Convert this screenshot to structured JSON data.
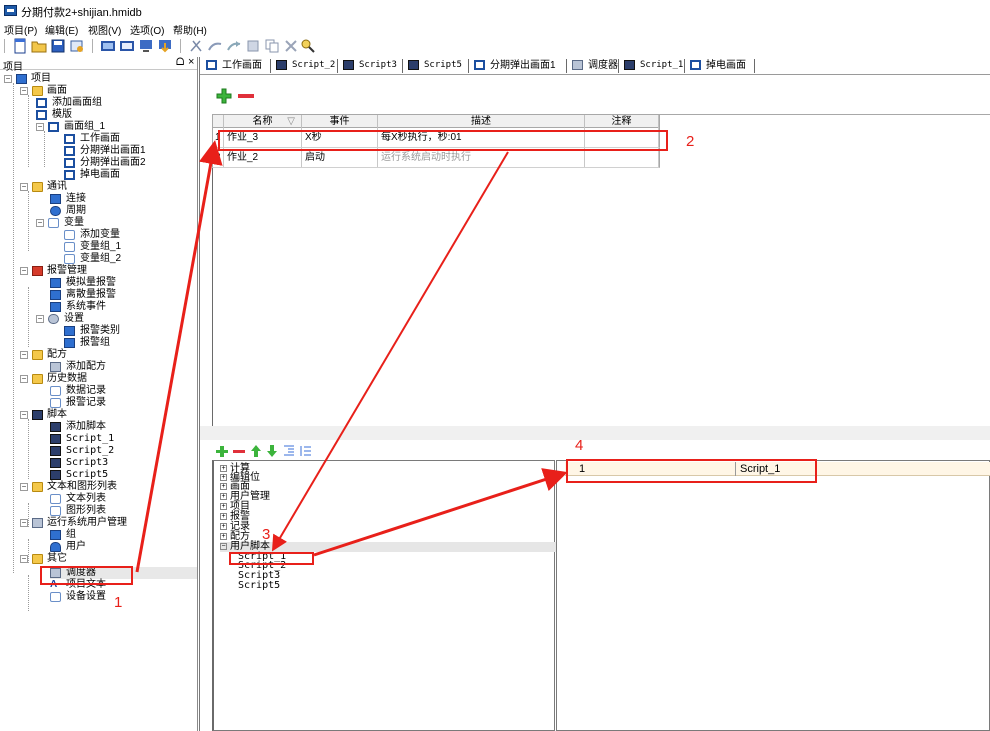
{
  "window": {
    "title": "分期付款2+shijian.hmidb"
  },
  "menu": [
    "项目(P)",
    "编辑(E)",
    "视图(V)",
    "选项(O)",
    "帮助(H)"
  ],
  "left_pane": {
    "header": "项目",
    "pin_icon": "pin-icon",
    "close_icon": "×",
    "tree": [
      {
        "label": "项目",
        "icon": "project-icon"
      },
      {
        "label": "画面",
        "icon": "folder-screen-icon"
      },
      {
        "label": "添加画面组",
        "icon": "screen-icon"
      },
      {
        "label": "模版",
        "icon": "screen-icon"
      },
      {
        "label": "画面组_1",
        "icon": "screen-icon"
      },
      {
        "label": "工作画面",
        "icon": "screen-icon"
      },
      {
        "label": "分期弹出画面1",
        "icon": "screen-icon"
      },
      {
        "label": "分期弹出画面2",
        "icon": "screen-icon"
      },
      {
        "label": "掉电画面",
        "icon": "screen-icon"
      },
      {
        "label": "通讯",
        "icon": "comm-icon"
      },
      {
        "label": "连接",
        "icon": "connection-icon"
      },
      {
        "label": "周期",
        "icon": "cycle-icon"
      },
      {
        "label": "变量",
        "icon": "variable-icon"
      },
      {
        "label": "添加变量",
        "icon": "variable-icon"
      },
      {
        "label": "变量组_1",
        "icon": "variable-icon"
      },
      {
        "label": "变量组_2",
        "icon": "variable-icon"
      },
      {
        "label": "报警管理",
        "icon": "alarm-icon"
      },
      {
        "label": "模拟量报警",
        "icon": "alarm-icon"
      },
      {
        "label": "离散量报警",
        "icon": "alarm-icon"
      },
      {
        "label": "系统事件",
        "icon": "alarm-icon"
      },
      {
        "label": "设置",
        "icon": "settings-icon"
      },
      {
        "label": "报警类别",
        "icon": "alarm-icon"
      },
      {
        "label": "报警组",
        "icon": "alarm-icon"
      },
      {
        "label": "配方",
        "icon": "recipe-icon"
      },
      {
        "label": "添加配方",
        "icon": "recipe-icon"
      },
      {
        "label": "历史数据",
        "icon": "history-icon"
      },
      {
        "label": "数据记录",
        "icon": "log-icon"
      },
      {
        "label": "报警记录",
        "icon": "log-icon"
      },
      {
        "label": "脚本",
        "icon": "script-icon"
      },
      {
        "label": "添加脚本",
        "icon": "script-icon"
      },
      {
        "label": "Script_1",
        "icon": "script-icon"
      },
      {
        "label": "Script_2",
        "icon": "script-icon"
      },
      {
        "label": "Script3",
        "icon": "script-icon"
      },
      {
        "label": "Script5",
        "icon": "script-icon"
      },
      {
        "label": "文本和图形列表",
        "icon": "list-icon"
      },
      {
        "label": "文本列表",
        "icon": "list-icon"
      },
      {
        "label": "图形列表",
        "icon": "list-icon"
      },
      {
        "label": "运行系统用户管理",
        "icon": "user-admin-icon"
      },
      {
        "label": "组",
        "icon": "group-icon"
      },
      {
        "label": "用户",
        "icon": "user-icon"
      },
      {
        "label": "其它",
        "icon": "folder-icon"
      },
      {
        "label": "调度器",
        "icon": "scheduler-icon"
      },
      {
        "label": "项目文本",
        "icon": "text-icon"
      },
      {
        "label": "设备设置",
        "icon": "device-icon"
      }
    ]
  },
  "tabs": [
    {
      "label": "工作画面",
      "icon": "screen-icon"
    },
    {
      "label": "Script_2",
      "icon": "script-icon"
    },
    {
      "label": "Script3",
      "icon": "script-icon"
    },
    {
      "label": "Script5",
      "icon": "script-icon"
    },
    {
      "label": "分期弹出画面1",
      "icon": "screen-icon"
    },
    {
      "label": "调度器",
      "icon": "scheduler-icon"
    },
    {
      "label": "Script_1",
      "icon": "script-icon"
    },
    {
      "label": "掉电画面",
      "icon": "screen-icon"
    }
  ],
  "task_table": {
    "columns": [
      "名称",
      "事件",
      "描述",
      "注释"
    ],
    "rows": [
      {
        "num": "1",
        "name": "作业_3",
        "event": "X秒",
        "desc": "每X秒执行，秒:01",
        "note": ""
      },
      {
        "num": "2",
        "name": "作业_2",
        "event": "启动",
        "desc": "运行系统启动时执行",
        "note": ""
      }
    ]
  },
  "function_tree": {
    "items": [
      {
        "label": "计算",
        "expander": "+"
      },
      {
        "label": "编辑位",
        "expander": "+"
      },
      {
        "label": "画面",
        "expander": "+"
      },
      {
        "label": "用户管理",
        "expander": "+"
      },
      {
        "label": "项目",
        "expander": "+"
      },
      {
        "label": "报警",
        "expander": "+"
      },
      {
        "label": "记录",
        "expander": "+"
      },
      {
        "label": "配方",
        "expander": "+"
      },
      {
        "label": "用户脚本",
        "expander": "−"
      }
    ],
    "children": [
      "Script_1",
      "Script_2",
      "Script3",
      "Script5"
    ]
  },
  "assignment": {
    "index": "1",
    "value": "Script_1"
  },
  "annotations": {
    "n1": "1",
    "n2": "2",
    "n3": "3",
    "n4": "4",
    "color": "#e8201a"
  }
}
